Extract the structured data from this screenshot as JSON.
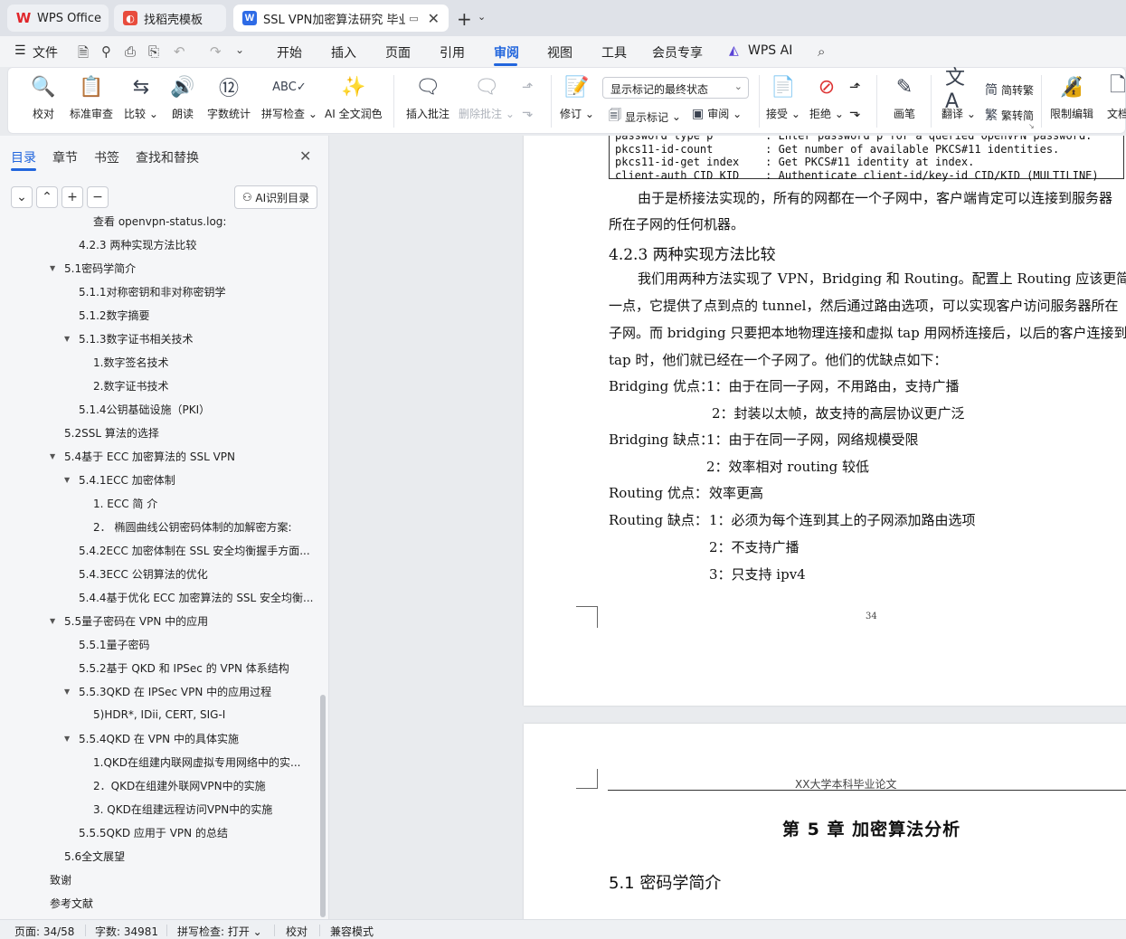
{
  "tabs": {
    "wps": "WPS Office",
    "daoke": "找稻壳模板",
    "doc": "SSL VPN加密算法研究 毕业论",
    "new": "+"
  },
  "menu": {
    "file": "文件",
    "items": [
      "开始",
      "插入",
      "页面",
      "引用",
      "审阅",
      "视图",
      "工具",
      "会员专享"
    ],
    "wps_ai": "WPS AI"
  },
  "ribbon": {
    "proofread": "校对",
    "std_review": "标准审查",
    "compare": "比较",
    "read": "朗读",
    "word_count": "字数统计",
    "spell_check": "拼写检查",
    "ai_polish": "AI 全文润色",
    "insert_comment": "插入批注",
    "delete_comment": "删除批注",
    "revise": "修订",
    "markup_mode": "显示标记的最终状态",
    "show_markup": "显示标记",
    "review_pane": "审阅",
    "accept": "接受",
    "reject": "拒绝",
    "pen": "画笔",
    "translate": "翻译",
    "to_traditional": "简转繁",
    "to_simplified": "繁转简",
    "restrict_edit": "限制编辑",
    "doc_more": "文档"
  },
  "nav": {
    "tabs": [
      "目录",
      "章节",
      "书签",
      "查找和替换"
    ],
    "ai_toc": "AI识别目录",
    "toc": [
      {
        "label": "查看 openvpn-status.log:",
        "level": 3,
        "tri": ""
      },
      {
        "label": "4.2.3 两种实现方法比较",
        "level": 2,
        "tri": ""
      },
      {
        "label": "5.1密码学简介",
        "level": 1,
        "tri": "▼"
      },
      {
        "label": "5.1.1对称密钥和非对称密钥学",
        "level": 2,
        "tri": ""
      },
      {
        "label": "5.1.2数字摘要",
        "level": 2,
        "tri": ""
      },
      {
        "label": "5.1.3数字证书相关技术",
        "level": 2,
        "tri": "▼"
      },
      {
        "label": "1.数字签名技术",
        "level": 3,
        "tri": ""
      },
      {
        "label": "2.数字证书技术",
        "level": 3,
        "tri": ""
      },
      {
        "label": "5.1.4公钥基础设施（PKI）",
        "level": 2,
        "tri": ""
      },
      {
        "label": "5.2SSL 算法的选择",
        "level": 1,
        "tri": ""
      },
      {
        "label": "5.4基于 ECC 加密算法的 SSL VPN",
        "level": 1,
        "tri": "▼"
      },
      {
        "label": "5.4.1ECC 加密体制",
        "level": 2,
        "tri": "▼"
      },
      {
        "label": "1. ECC 简 介",
        "level": 3,
        "tri": ""
      },
      {
        "label": "2．  椭圆曲线公钥密码体制的加解密方案:",
        "level": 3,
        "tri": ""
      },
      {
        "label": "5.4.2ECC 加密体制在 SSL 安全均衡握手方面...",
        "level": 2,
        "tri": ""
      },
      {
        "label": "5.4.3ECC 公钥算法的优化",
        "level": 2,
        "tri": ""
      },
      {
        "label": "5.4.4基于优化 ECC 加密算法的 SSL 安全均衡...",
        "level": 2,
        "tri": ""
      },
      {
        "label": "5.5量子密码在 VPN 中的应用",
        "level": 1,
        "tri": "▼"
      },
      {
        "label": "5.5.1量子密码",
        "level": 2,
        "tri": ""
      },
      {
        "label": "5.5.2基于 QKD 和 IPSec 的 VPN 体系结构",
        "level": 2,
        "tri": ""
      },
      {
        "label": "5.5.3QKD 在 IPSec VPN 中的应用过程",
        "level": 2,
        "tri": "▼"
      },
      {
        "label": "5)HDR*, IDii, CERT, SIG-I",
        "level": 3,
        "tri": ""
      },
      {
        "label": "5.5.4QKD 在 VPN 中的具体实施",
        "level": 2,
        "tri": "▼"
      },
      {
        "label": "1.QKD在组建内联网虚拟专用网络中的实...",
        "level": 3,
        "tri": ""
      },
      {
        "label": "2．QKD在组建外联网VPN中的实施",
        "level": 3,
        "tri": ""
      },
      {
        "label": "3. QKD在组建远程访问VPN中的实施",
        "level": 3,
        "tri": ""
      },
      {
        "label": "5.5.5QKD 应用于 VPN 的总结",
        "level": 2,
        "tri": ""
      },
      {
        "label": "5.6全文展望",
        "level": 1,
        "tri": ""
      },
      {
        "label": "致谢",
        "level": 0,
        "tri": ""
      },
      {
        "label": "参考文献",
        "level": 0,
        "tri": ""
      }
    ]
  },
  "doc": {
    "code_lines": [
      "password type p        : Enter password p for a queried OpenVPN password.",
      "pkcs11-id-count        : Get number of available PKCS#11 identities.",
      "pkcs11-id-get index    : Get PKCS#11 identity at index.",
      "client-auth CID KID    : Authenticate client-id/key-id CID/KID (MULTILINE)"
    ],
    "para1_a": "由于是桥接法实现的，所有的网都在一个子网中，客户端肯定可以连接到服务器",
    "para1_b": "所在子网的任何机器。",
    "heading": "4.2.3 两种实现方法比较",
    "para2": [
      "我们用两种方法实现了  VPN，Bridging 和 Routing。配置上  Routing 应该更简单",
      "一点，它提供了点到点的  tunnel，然后通过路由选项，可以实现客户访问服务器所在",
      "子网。而  bridging 只要把本地物理连接和虚拟  tap 用网桥连接后，以后的客户连接到",
      "tap 时，他们就已经在一个子网了。他们的优缺点如下："
    ],
    "bridging_pro_label": "Bridging 优点：",
    "bridging_pro": [
      "1：由于在同一子网，不用路由，支持广播",
      "2：封装以太帧，故支持的高层协议更广泛"
    ],
    "bridging_con_label": "Bridging 缺点：",
    "bridging_con": [
      "1：由于在同一子网，网络规模受限",
      "2：效率相对  routing 较低"
    ],
    "routing_pro_label": "Routing 优点：",
    "routing_pro": "效率更高",
    "routing_con_label": "Routing 缺点：",
    "routing_con": [
      "1：必须为每个连到其上的子网添加路由选项",
      "2：不支持广播",
      "3：只支持  ipv4"
    ],
    "page_number": "34",
    "page2_header": "XX大学本科毕业论文",
    "chapter_title": "第  5  章   加密算法分析",
    "section_title": "5.1    密码学简介"
  },
  "status": {
    "page": "页面: 34/58",
    "words": "字数: 34981",
    "spell": "拼写检查: 打开",
    "proof": "校对",
    "compat": "兼容模式"
  },
  "colors": {
    "accent": "#2266dd",
    "wps_red": "#e0262b",
    "doc_blue": "#2e6be6"
  }
}
